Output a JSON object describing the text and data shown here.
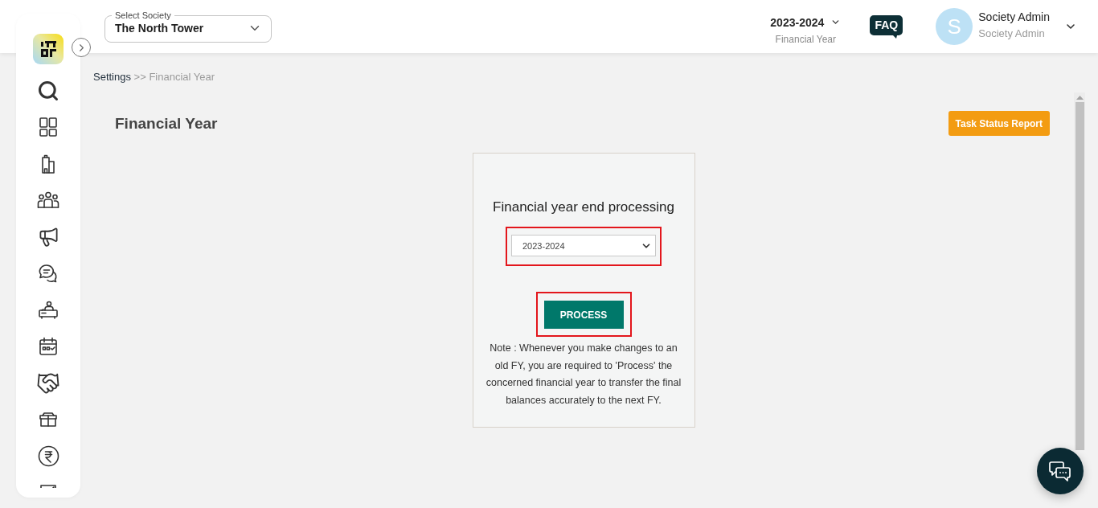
{
  "header": {
    "society_select": {
      "label": "Select Society",
      "value": "The North Tower"
    },
    "financial_year": {
      "value": "2023-2024",
      "caption": "Financial Year"
    },
    "faq": "FAQ",
    "user": {
      "initial": "S",
      "name": "Society Admin",
      "role": "Society Admin"
    }
  },
  "breadcrumb": {
    "items": [
      "Settings",
      "Financial Year"
    ],
    "separator": ">>"
  },
  "page": {
    "title": "Financial Year",
    "task_status_button": "Task Status Report"
  },
  "processing_card": {
    "title": "Financial year end processing",
    "year_select": {
      "value": "2023-2024",
      "highlighted": true
    },
    "process_button": {
      "label": "PROCESS",
      "highlighted": true
    },
    "note": "Note : Whenever you make changes to an old FY, you are required to 'Process' the concerned financial year to transfer the final balances accurately to the next FY."
  }
}
